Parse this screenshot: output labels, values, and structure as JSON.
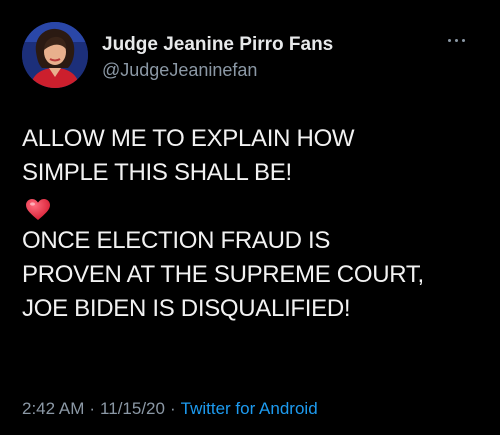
{
  "tweet": {
    "author": {
      "display_name": "Judge Jeanine Pirro Fans",
      "handle": "@JudgeJeaninefan",
      "avatar_icon": "profile-photo"
    },
    "more_icon": "ellipsis-icon",
    "lines": [
      "ALLOW ME TO EXPLAIN HOW",
      "SIMPLE THIS SHALL BE!"
    ],
    "emoji": "heart-emoji",
    "lines2": [
      "ONCE ELECTION FRAUD IS",
      "PROVEN AT THE SUPREME COURT,",
      "JOE BIDEN IS DISQUALIFIED!"
    ],
    "meta": {
      "time": "2:42 AM",
      "separator": "·",
      "date": "11/15/20",
      "source": "Twitter for Android"
    }
  },
  "colors": {
    "background": "#000000",
    "text": "#e7e9ea",
    "secondary": "#8b98a5",
    "link": "#1d9bf0",
    "heart": "#e0245e"
  }
}
